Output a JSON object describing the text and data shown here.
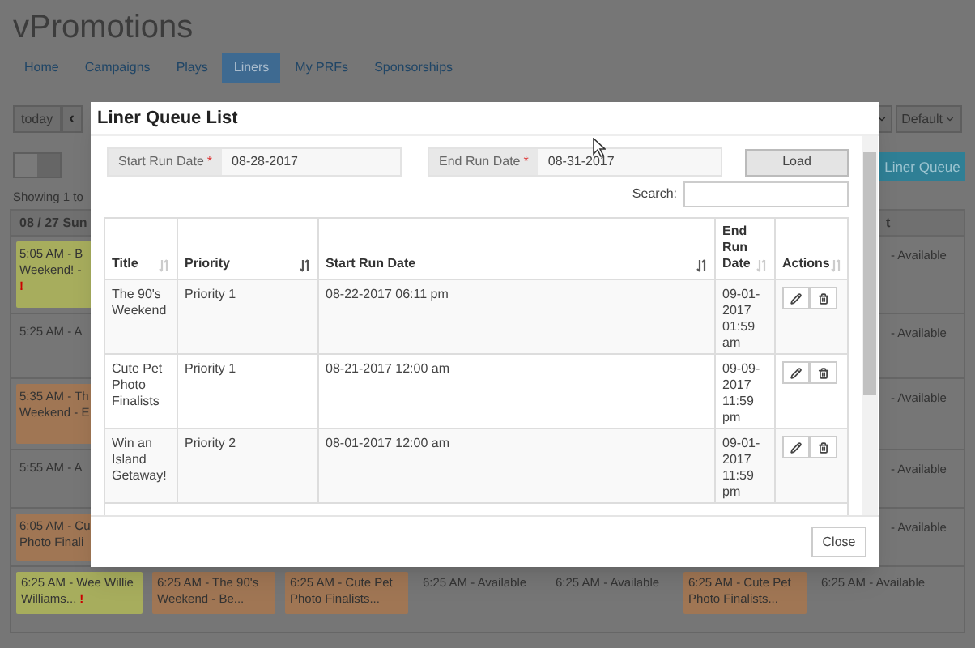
{
  "app": {
    "title": "vPromotions"
  },
  "nav_tabs": [
    {
      "label": "Home",
      "selected": false
    },
    {
      "label": "Campaigns",
      "selected": false
    },
    {
      "label": "Plays",
      "selected": false
    },
    {
      "label": "Liners",
      "selected": true
    },
    {
      "label": "My PRFs",
      "selected": false
    },
    {
      "label": "Sponsorships",
      "selected": false
    }
  ],
  "toolbar": {
    "today": "today",
    "prev": "‹",
    "default_menu": "Default",
    "liner_queue_button": "Liner Queue",
    "view_toggle": {
      "on": false
    }
  },
  "showing_text": "Showing 1 to",
  "calendar": {
    "first_header": "08 / 27 Sun",
    "last_header": "t",
    "rows": [
      {
        "first": {
          "lines": [
            "5:05 AM - B",
            "Weekend! -"
          ],
          "alert": "!",
          "color": "#a7ad5d"
        },
        "last": "- Available"
      },
      {
        "first": {
          "lines": [
            "5:25 AM - A"
          ]
        },
        "last": "- Available"
      },
      {
        "first": {
          "lines": [
            "5:35 AM - Th",
            "Weekend - E"
          ],
          "color": "#a07654"
        },
        "last": "- Available"
      },
      {
        "first": {
          "lines": [
            "5:55 AM - A"
          ]
        },
        "last": "- Available"
      },
      {
        "first": {
          "lines": [
            "6:05 AM - Cu",
            "Photo Finali"
          ],
          "color": "#a07654"
        },
        "last": "- Available"
      }
    ],
    "bottom_row": [
      {
        "text": "6:25 AM - Wee Willie Williams...",
        "alert": "!",
        "color": "#a7ad5d"
      },
      {
        "text": "6:25 AM - The 90's Weekend - Be...",
        "color": "#a07654"
      },
      {
        "text": "6:25 AM - Cute Pet Photo Finalists...",
        "color": "#a07654"
      },
      {
        "text": "6:25 AM - Available"
      },
      {
        "text": "6:25 AM - Available"
      },
      {
        "text": "6:25 AM - Cute Pet Photo Finalists...",
        "color": "#a07654"
      },
      {
        "text": "6:25 AM - Available"
      }
    ]
  },
  "modal": {
    "title": "Liner Queue List",
    "start_date": {
      "label": "Start Run Date",
      "required": "*",
      "value": "08-28-2017"
    },
    "end_date": {
      "label": "End Run Date",
      "required": "*",
      "value": "08-31-2017"
    },
    "load_button": "Load",
    "search_label": "Search:",
    "table": {
      "columns": [
        {
          "label": "Title",
          "sorted": false
        },
        {
          "label": "Priority",
          "sorted": true
        },
        {
          "label": "Start Run Date",
          "sorted": true
        },
        {
          "label": "End Run Date",
          "sorted": false
        },
        {
          "label": "Actions",
          "sorted": false
        }
      ],
      "rows": [
        {
          "title": "The 90's Weekend",
          "priority": "Priority 1",
          "start": "08-22-2017 06:11 pm",
          "end": "09-01-2017 01:59 am"
        },
        {
          "title": "Cute Pet Photo Finalists",
          "priority": "Priority 1",
          "start": "08-21-2017 12:00 am",
          "end": "09-09-2017 11:59 pm"
        },
        {
          "title": "Win an Island Getaway!",
          "priority": "Priority 2",
          "start": "08-01-2017 12:00 am",
          "end": "09-01-2017 11:59 pm"
        }
      ]
    },
    "close_button": "Close"
  }
}
